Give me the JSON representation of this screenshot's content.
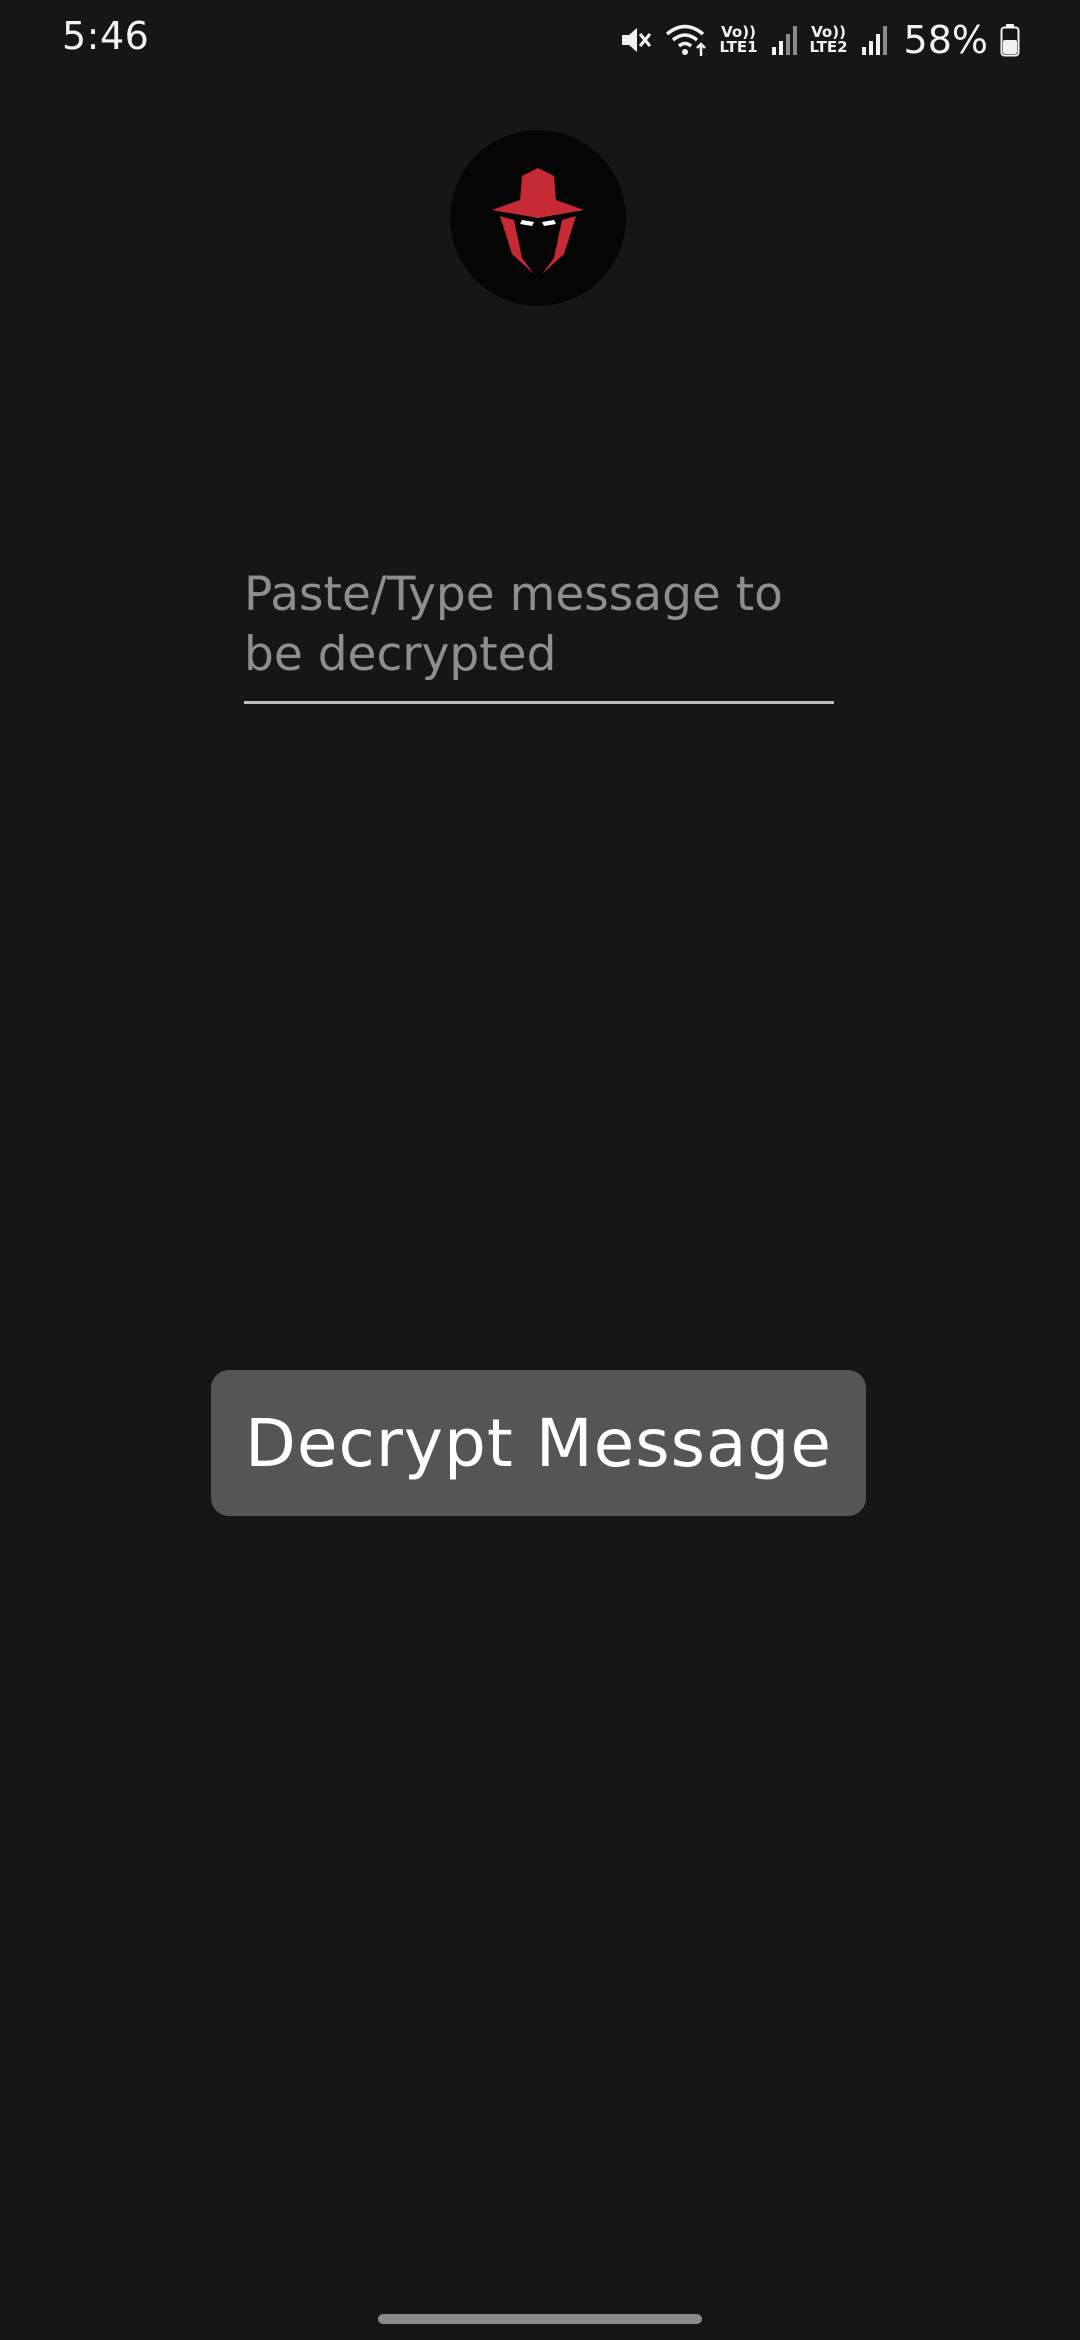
{
  "status_bar": {
    "time": "5:46",
    "sim1_label_top": "Vo))",
    "sim1_label_bottom": "LTE1",
    "sim2_label_top": "Vo))",
    "sim2_label_bottom": "LTE2",
    "battery_percent": "58%",
    "icons": [
      "mute-icon",
      "wifi-icon",
      "signal-icon",
      "battery-icon"
    ]
  },
  "logo": {
    "icon": "spy-hat-icon",
    "accent_color": "#c62a35"
  },
  "form": {
    "message_placeholder": "Paste/Type message to be decrypted",
    "message_value": ""
  },
  "actions": {
    "decrypt_label": "Decrypt Message"
  },
  "colors": {
    "background": "#161616",
    "button": "#555555",
    "placeholder": "#8e8e8e"
  }
}
